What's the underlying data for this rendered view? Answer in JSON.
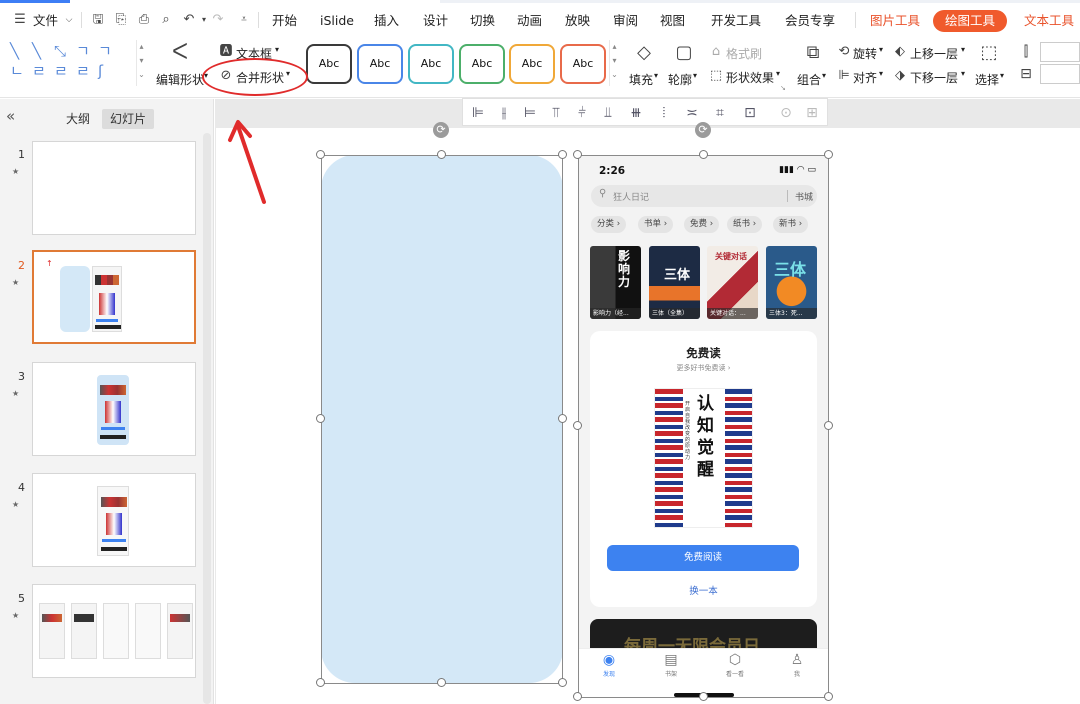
{
  "menubar": {
    "file_label": "文件",
    "tabs": [
      "开始",
      "iSlide",
      "插入",
      "设计",
      "切换",
      "动画",
      "放映",
      "审阅",
      "视图",
      "开发工具",
      "会员专享"
    ],
    "context_tabs": {
      "picture_tools": "图片工具",
      "drawing_tools": "绘图工具",
      "text_tools": "文本工具"
    }
  },
  "ribbon": {
    "edit_shape": "编辑形状",
    "text_box": "文本框",
    "merge_shapes": "合并形状",
    "style_label": "Abc",
    "style_colors": [
      "#3a3a3a",
      "#4a86e8",
      "#42b7c4",
      "#4caf6a",
      "#f0a838",
      "#e86a4a"
    ],
    "fill": "填充",
    "outline": "轮廓",
    "format_painter": "格式刷",
    "shape_effects": "形状效果",
    "group": "组合",
    "rotate": "旋转",
    "align": "对齐",
    "bring_forward": "上移一层",
    "send_backward": "下移一层",
    "select": "选择"
  },
  "left_panel": {
    "outline_tab": "大纲",
    "slides_tab": "幻灯片",
    "slides": [
      {
        "num": "1",
        "active": false
      },
      {
        "num": "2",
        "active": true
      },
      {
        "num": "3",
        "active": false
      },
      {
        "num": "4",
        "active": false
      },
      {
        "num": "5",
        "active": false
      }
    ]
  },
  "phone": {
    "time": "2:26",
    "search_placeholder": "狂人日记",
    "bookstore": "书城",
    "chips": [
      "分类 ›",
      "书单 ›",
      "免费 ›",
      "纸书 ›",
      "新书 ›"
    ],
    "books": [
      {
        "cover_text": "影响力",
        "caption": "影响力（经..."
      },
      {
        "cover_text": "三体",
        "caption": "三体（全集）"
      },
      {
        "cover_text": "关键对话",
        "caption": "关键对话：..."
      },
      {
        "cover_text": "三体",
        "caption": "三体3：死..."
      }
    ],
    "free_title": "免费读",
    "free_subtitle": "更多好书免费读 ›",
    "cover_title": "认知觉醒",
    "cover_subtitle": "开启自我改变的原动力",
    "read_button": "免费阅读",
    "swap": "换一本",
    "banner": "每周一无限会员日",
    "tabs": [
      "发现",
      "书架",
      "看一看",
      "我"
    ]
  }
}
